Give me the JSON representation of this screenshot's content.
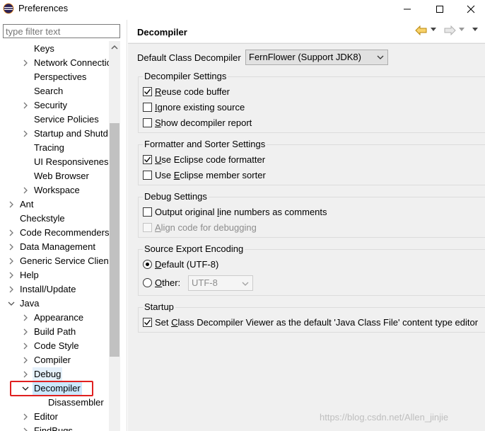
{
  "window": {
    "title": "Preferences"
  },
  "filter": {
    "placeholder": "type filter text"
  },
  "tree": {
    "items": [
      {
        "label": "Keys",
        "arrow": false
      },
      {
        "label": "Network Connectio",
        "arrow": true
      },
      {
        "label": "Perspectives",
        "arrow": false
      },
      {
        "label": "Search",
        "arrow": false
      },
      {
        "label": "Security",
        "arrow": true
      },
      {
        "label": "Service Policies",
        "arrow": false
      },
      {
        "label": "Startup and Shutd",
        "arrow": true
      },
      {
        "label": "Tracing",
        "arrow": false
      },
      {
        "label": "UI Responsiveness",
        "arrow": false
      },
      {
        "label": "Web Browser",
        "arrow": false
      },
      {
        "label": "Workspace",
        "arrow": true
      },
      {
        "label": "Ant",
        "arrow": true
      },
      {
        "label": "Checkstyle",
        "arrow": false
      },
      {
        "label": "Code Recommenders",
        "arrow": true
      },
      {
        "label": "Data Management",
        "arrow": true
      },
      {
        "label": "Generic Service Client",
        "arrow": true
      },
      {
        "label": "Help",
        "arrow": true
      },
      {
        "label": "Install/Update",
        "arrow": true
      },
      {
        "label": "Java",
        "arrow": "down"
      },
      {
        "label": "Appearance",
        "arrow": true
      },
      {
        "label": "Build Path",
        "arrow": true
      },
      {
        "label": "Code Style",
        "arrow": true
      },
      {
        "label": "Compiler",
        "arrow": true
      },
      {
        "label": "Debug",
        "arrow": true
      },
      {
        "label": "Decompiler",
        "arrow": "down"
      },
      {
        "label": "Disassembler",
        "arrow": false
      },
      {
        "label": "Editor",
        "arrow": true
      },
      {
        "label": "FindBugs",
        "arrow": true
      }
    ]
  },
  "page": {
    "title": "Decompiler",
    "default_decompiler_label": "Default Class Decompiler",
    "default_decompiler_value": "FernFlower (Support JDK8)"
  },
  "groups": {
    "decompiler_settings": {
      "title": "Decompiler Settings",
      "options": [
        {
          "pre": "",
          "u": "R",
          "post": "euse code buffer",
          "checked": true
        },
        {
          "pre": "",
          "u": "I",
          "post": "gnore existing source",
          "checked": false
        },
        {
          "pre": "",
          "u": "S",
          "post": "how decompiler report",
          "checked": false
        }
      ]
    },
    "formatter": {
      "title": "Formatter and Sorter Settings",
      "options": [
        {
          "pre": "",
          "u": "U",
          "post": "se Eclipse code formatter",
          "checked": true
        },
        {
          "pre": "Use ",
          "u": "E",
          "post": "clipse member sorter",
          "checked": false
        }
      ]
    },
    "debug": {
      "title": "Debug Settings",
      "options": [
        {
          "pre": "Output original ",
          "u": "l",
          "post": "ine numbers as comments",
          "checked": false
        },
        {
          "pre": "",
          "u": "A",
          "post": "lign code for debugging",
          "checked": false,
          "disabled": true
        }
      ]
    },
    "encoding": {
      "title": "Source Export Encoding",
      "default_pre": "",
      "default_u": "D",
      "default_post": "efault (UTF-8)",
      "other_pre": "",
      "other_u": "O",
      "other_post": "ther:",
      "other_value": "UTF-8"
    },
    "startup": {
      "title": "Startup",
      "pre": "Set ",
      "u": "C",
      "post": "lass Decompiler Viewer as the default 'Java Class File' content type editor",
      "checked": true
    }
  },
  "watermark": "https://blog.csdn.net/Allen_jinjie",
  "colors": {
    "selection": "#cce8ff",
    "highlight_box": "#e02020",
    "panel_bg": "#f0f0f0"
  }
}
